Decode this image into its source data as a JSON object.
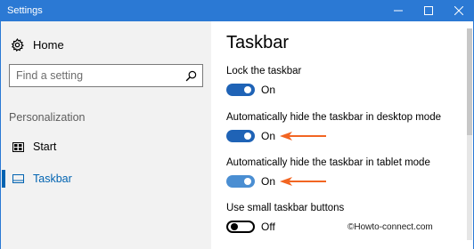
{
  "window": {
    "title": "Settings",
    "accent_color": "#2b79d4"
  },
  "sidebar": {
    "home_label": "Home",
    "search_placeholder": "Find a setting",
    "section_label": "Personalization",
    "items": [
      {
        "label": "Start",
        "icon": "start-menu-icon",
        "selected": false
      },
      {
        "label": "Taskbar",
        "icon": "taskbar-icon",
        "selected": true
      }
    ]
  },
  "main": {
    "title": "Taskbar",
    "settings": [
      {
        "label": "Lock the taskbar",
        "state": "On"
      },
      {
        "label": "Automatically hide the taskbar in desktop mode",
        "state": "On"
      },
      {
        "label": "Automatically hide the taskbar in tablet mode",
        "state": "On"
      },
      {
        "label": "Use small taskbar buttons",
        "state": "Off"
      }
    ],
    "annotation_arrow_color": "#f26522"
  },
  "watermark": "©Howto-connect.com"
}
